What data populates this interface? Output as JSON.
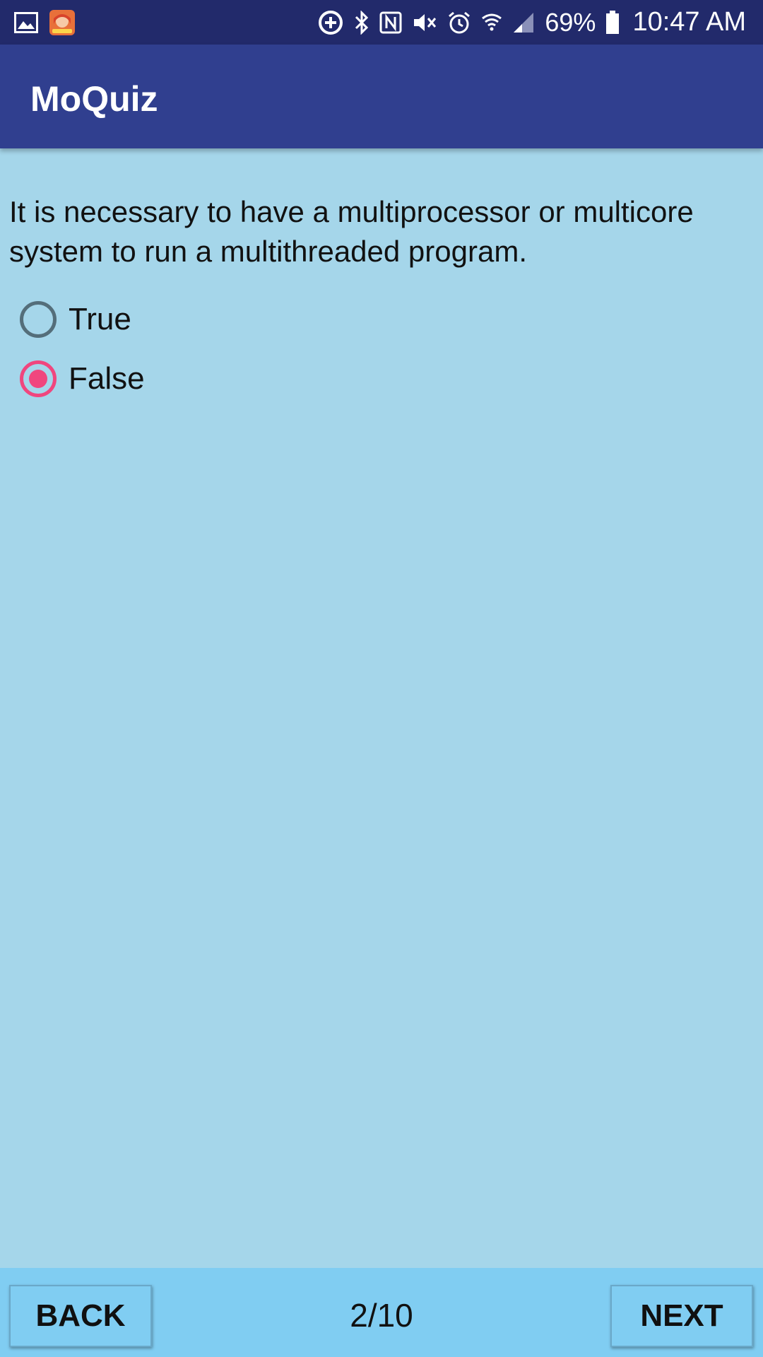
{
  "status_bar": {
    "battery_percent": "69%",
    "time": "10:47 AM",
    "icons": [
      "gallery-icon",
      "game-app-icon",
      "data-saver-icon",
      "bluetooth-icon",
      "nfc-icon",
      "mute-icon",
      "alarm-icon",
      "wifi-icon",
      "signal-icon",
      "battery-icon"
    ]
  },
  "app_bar": {
    "title": "MoQuiz"
  },
  "quiz": {
    "question": "It is necessary to have a multiprocessor or multicore system to run a multithreaded program.",
    "options": [
      {
        "label": "True",
        "selected": false
      },
      {
        "label": "False",
        "selected": true
      }
    ]
  },
  "navigation": {
    "back_label": "BACK",
    "next_label": "NEXT",
    "progress": "2/10"
  },
  "colors": {
    "status_bar": "#222a6b",
    "app_bar": "#303f8f",
    "background": "#a5d6ea",
    "bottom_bar": "#80cdf2",
    "radio_selected": "#f0467e",
    "radio_unselected": "#546e7a"
  }
}
